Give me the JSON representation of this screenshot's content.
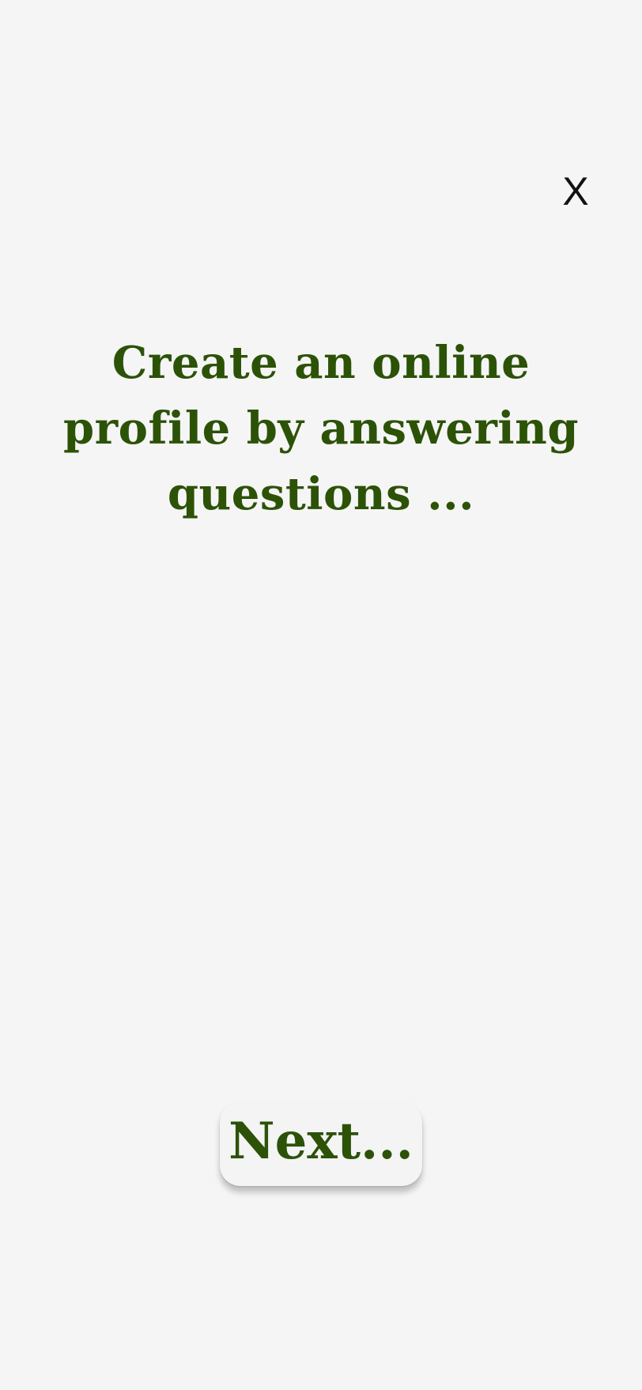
{
  "header": {
    "close_label": "X"
  },
  "main": {
    "headline": "Create an online profile by answering questions ..."
  },
  "footer": {
    "next_label": "Next..."
  },
  "colors": {
    "background": "#f5f5f5",
    "accent_text": "#2c5207",
    "close_text": "#111111"
  }
}
